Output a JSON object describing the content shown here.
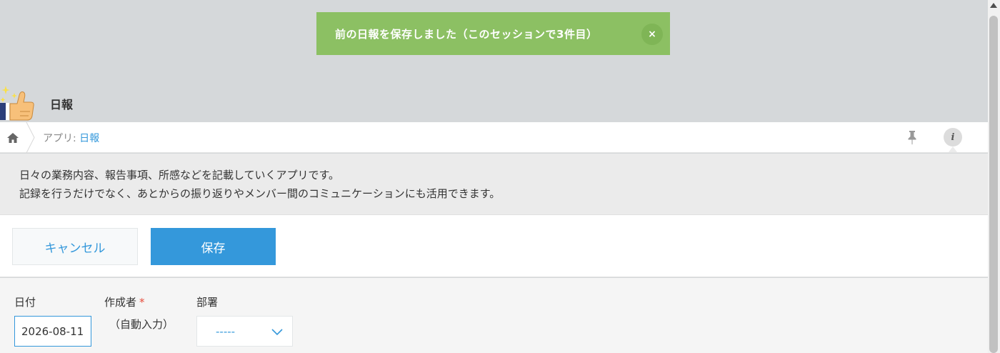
{
  "toast": {
    "message": "前の日報を保存しました（このセッションで3件目）",
    "close_label": "×"
  },
  "app": {
    "title": "日報",
    "icon": "thumbs-up-sparkle-icon"
  },
  "breadcrumb": {
    "prefix": "アプリ: ",
    "app_link": "日報"
  },
  "description": {
    "line1": "日々の業務内容、報告事項、所感などを記載していくアプリです。",
    "line2": "記録を行うだけでなく、あとからの振り返りやメンバー間のコミュニケーションにも活用できます。"
  },
  "toolbar": {
    "cancel_label": "キャンセル",
    "save_label": "保存"
  },
  "form": {
    "date_label": "日付",
    "date_value": "2026-08-11",
    "author_label": "作成者",
    "required_mark": "*",
    "author_value": "（自動入力）",
    "dept_label": "部署",
    "dept_value": "-----"
  },
  "colors": {
    "accent": "#3498db",
    "toast": "#8cc063",
    "required": "#e74c3c"
  }
}
